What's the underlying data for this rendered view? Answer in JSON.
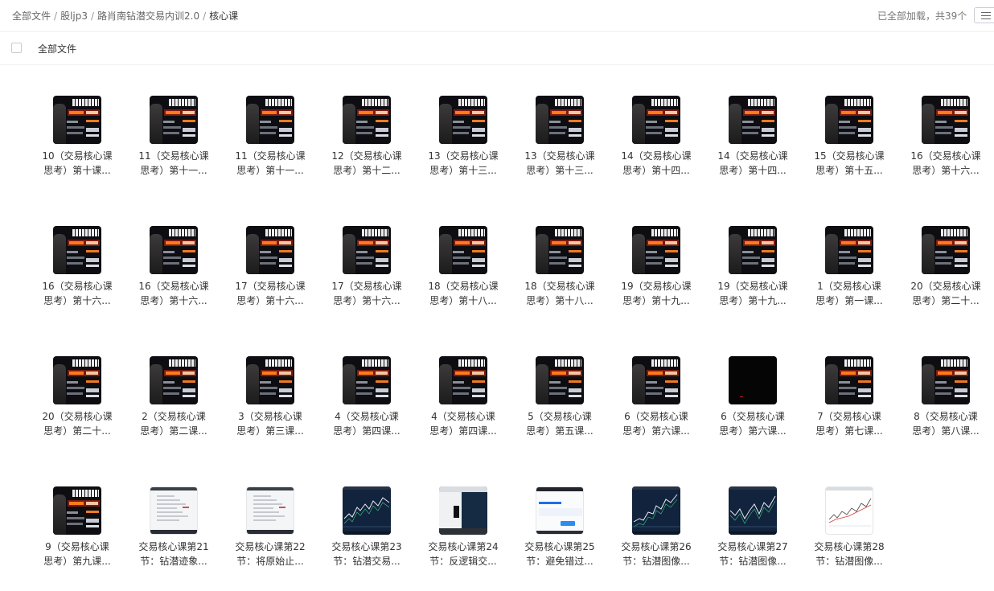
{
  "breadcrumb": {
    "items": [
      "全部文件",
      "股ljp3",
      "路肖南钻潜交易内训2.0"
    ],
    "separator": "/",
    "current": "核心课"
  },
  "status": {
    "loaded_text": "已全部加载，共39个"
  },
  "list_header": {
    "label": "全部文件"
  },
  "cover_text": "用视频",
  "files": [
    {
      "thumb": "cover",
      "line1": "10（交易核心课",
      "line2": "思考）第十课..."
    },
    {
      "thumb": "cover",
      "line1": "11（交易核心课",
      "line2": "思考）第十一..."
    },
    {
      "thumb": "cover",
      "line1": "11（交易核心课",
      "line2": "思考）第十一..."
    },
    {
      "thumb": "cover",
      "line1": "12（交易核心课",
      "line2": "思考）第十二..."
    },
    {
      "thumb": "cover",
      "line1": "13（交易核心课",
      "line2": "思考）第十三..."
    },
    {
      "thumb": "cover",
      "line1": "13（交易核心课",
      "line2": "思考）第十三..."
    },
    {
      "thumb": "cover",
      "line1": "14（交易核心课",
      "line2": "思考）第十四..."
    },
    {
      "thumb": "cover",
      "line1": "14（交易核心课",
      "line2": "思考）第十四..."
    },
    {
      "thumb": "cover",
      "line1": "15（交易核心课",
      "line2": "思考）第十五..."
    },
    {
      "thumb": "cover",
      "line1": "16（交易核心课",
      "line2": "思考）第十六..."
    },
    {
      "thumb": "cover",
      "line1": "16（交易核心课",
      "line2": "思考）第十六..."
    },
    {
      "thumb": "cover",
      "line1": "16（交易核心课",
      "line2": "思考）第十六..."
    },
    {
      "thumb": "cover",
      "line1": "17（交易核心课",
      "line2": "思考）第十六..."
    },
    {
      "thumb": "cover",
      "line1": "17（交易核心课",
      "line2": "思考）第十六..."
    },
    {
      "thumb": "cover",
      "line1": "18（交易核心课",
      "line2": "思考）第十八..."
    },
    {
      "thumb": "cover",
      "line1": "18（交易核心课",
      "line2": "思考）第十八..."
    },
    {
      "thumb": "cover",
      "line1": "19（交易核心课",
      "line2": "思考）第十九..."
    },
    {
      "thumb": "cover",
      "line1": "19（交易核心课",
      "line2": "思考）第十九..."
    },
    {
      "thumb": "cover",
      "line1": "1（交易核心课",
      "line2": "思考）第一课..."
    },
    {
      "thumb": "cover",
      "line1": "20（交易核心课",
      "line2": "思考）第二十..."
    },
    {
      "thumb": "cover",
      "line1": "20（交易核心课",
      "line2": "思考）第二十..."
    },
    {
      "thumb": "cover",
      "line1": "2（交易核心课",
      "line2": "思考）第二课..."
    },
    {
      "thumb": "cover",
      "line1": "3（交易核心课",
      "line2": "思考）第三课..."
    },
    {
      "thumb": "cover",
      "line1": "4（交易核心课",
      "line2": "思考）第四课..."
    },
    {
      "thumb": "cover",
      "line1": "4（交易核心课",
      "line2": "思考）第四课..."
    },
    {
      "thumb": "cover",
      "line1": "5（交易核心课",
      "line2": "思考）第五课..."
    },
    {
      "thumb": "cover",
      "line1": "6（交易核心课",
      "line2": "思考）第六课..."
    },
    {
      "thumb": "black",
      "line1": "6（交易核心课",
      "line2": "思考）第六课..."
    },
    {
      "thumb": "cover",
      "line1": "7（交易核心课",
      "line2": "思考）第七课..."
    },
    {
      "thumb": "cover",
      "line1": "8（交易核心课",
      "line2": "思考）第八课..."
    },
    {
      "thumb": "cover",
      "line1": "9（交易核心课",
      "line2": "思考）第九课..."
    },
    {
      "thumb": "doc",
      "line1": "交易核心课第21",
      "line2": "节：钻潜迹象..."
    },
    {
      "thumb": "doc",
      "line1": "交易核心课第22",
      "line2": "节：将原始止..."
    },
    {
      "thumb": "chart",
      "line1": "交易核心课第23",
      "line2": "节：钻潜交易..."
    },
    {
      "thumb": "mixed",
      "line1": "交易核心课第24",
      "line2": "节：反逻辑交..."
    },
    {
      "thumb": "app",
      "line1": "交易核心课第25",
      "line2": "节：避免错过..."
    },
    {
      "thumb": "chart",
      "line1": "交易核心课第26",
      "line2": "节：钻潜图像..."
    },
    {
      "thumb": "chart",
      "line1": "交易核心课第27",
      "line2": "节：钻潜图像..."
    },
    {
      "thumb": "wchart",
      "line1": "交易核心课第28",
      "line2": "节：钻潜图像..."
    }
  ]
}
